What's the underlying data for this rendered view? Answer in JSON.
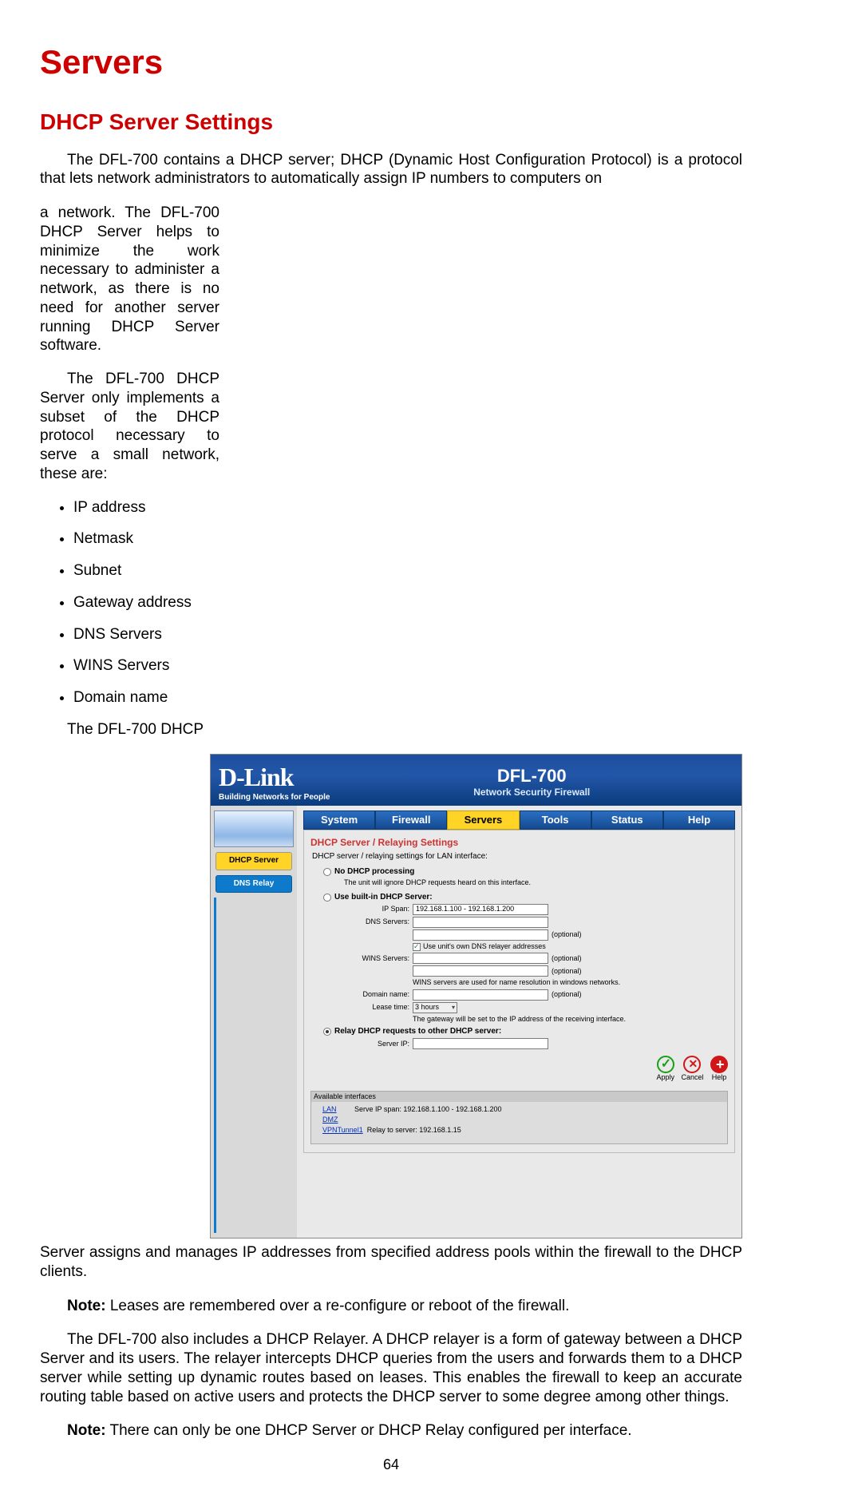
{
  "page_title": "Servers",
  "section_title": "DHCP Server Settings",
  "intro_para": "The DFL-700 contains a DHCP server; DHCP (Dynamic Host Configuration Protocol) is a protocol that lets network administrators to automatically assign IP numbers to computers on",
  "left": {
    "p1": "a network. The DFL-700 DHCP Server helps to minimize the work necessary to administer a network, as there is no need for another server running DHCP Server software.",
    "p2": "The DFL-700 DHCP Server only implements a subset of the DHCP protocol necessary to serve a small network, these are:",
    "items": [
      "IP address",
      "Netmask",
      "Subnet",
      "Gateway address",
      "DNS Servers",
      "WINS Servers",
      "Domain name"
    ],
    "p3": "The DFL-700 DHCP"
  },
  "shot": {
    "brand_top": "D-Link",
    "brand_sub": "Building Networks for People",
    "device_name": "DFL-700",
    "device_tag": "Network Security Firewall",
    "sidebar": {
      "item1": "DHCP Server",
      "item2": "DNS Relay"
    },
    "tabs": [
      "System",
      "Firewall",
      "Servers",
      "Tools",
      "Status",
      "Help"
    ],
    "panel_title": "DHCP Server / Relaying Settings",
    "note_line": "DHCP server / relaying settings for LAN interface:",
    "radio1": "No DHCP processing",
    "radio1_desc": "The unit will ignore DHCP requests heard on this interface.",
    "radio2": "Use built-in DHCP Server:",
    "labels": {
      "ip_span": "IP Span:",
      "dns": "DNS Servers:",
      "wins": "WINS Servers:",
      "domain": "Domain name:",
      "lease": "Lease time:",
      "server_ip": "Server IP:"
    },
    "values": {
      "ip_span": "192.168.1.100 - 192.168.1.200",
      "optional": "(optional)",
      "use_own_dns": "Use unit's own DNS relayer addresses",
      "wins_note": "WINS servers are used for name resolution in windows networks.",
      "lease": "3 hours",
      "gateway_note": "The gateway will be set to the IP address of the receiving interface."
    },
    "radio3": "Relay DHCP requests to other DHCP server:",
    "buttons": {
      "apply": "Apply",
      "cancel": "Cancel",
      "help": "Help"
    },
    "avail": {
      "title": "Available interfaces",
      "lan": "LAN",
      "lan_txt": "Serve IP span: 192.168.1.100 - 192.168.1.200",
      "dmz": "DMZ",
      "vpn": "VPNTunnel1",
      "vpn_txt": "Relay to server: 192.168.1.15"
    }
  },
  "after": {
    "p1": "Server assigns and manages IP addresses from specified address pools within the firewall to the DHCP clients.",
    "note1_label": "Note:",
    "note1": " Leases are remembered over a re-configure or reboot of the firewall.",
    "p2": "The DFL-700 also includes a DHCP Relayer. A DHCP relayer is a form of gateway between a DHCP Server and its users. The relayer intercepts DHCP queries from the users and forwards them to a DHCP server while setting up dynamic routes based on leases. This enables the firewall to keep an accurate routing table based on active users and protects the DHCP server to some degree among other things.",
    "note2_label": "Note:",
    "note2": " There can only be one DHCP Server or DHCP Relay configured per interface."
  },
  "page_number": "64"
}
